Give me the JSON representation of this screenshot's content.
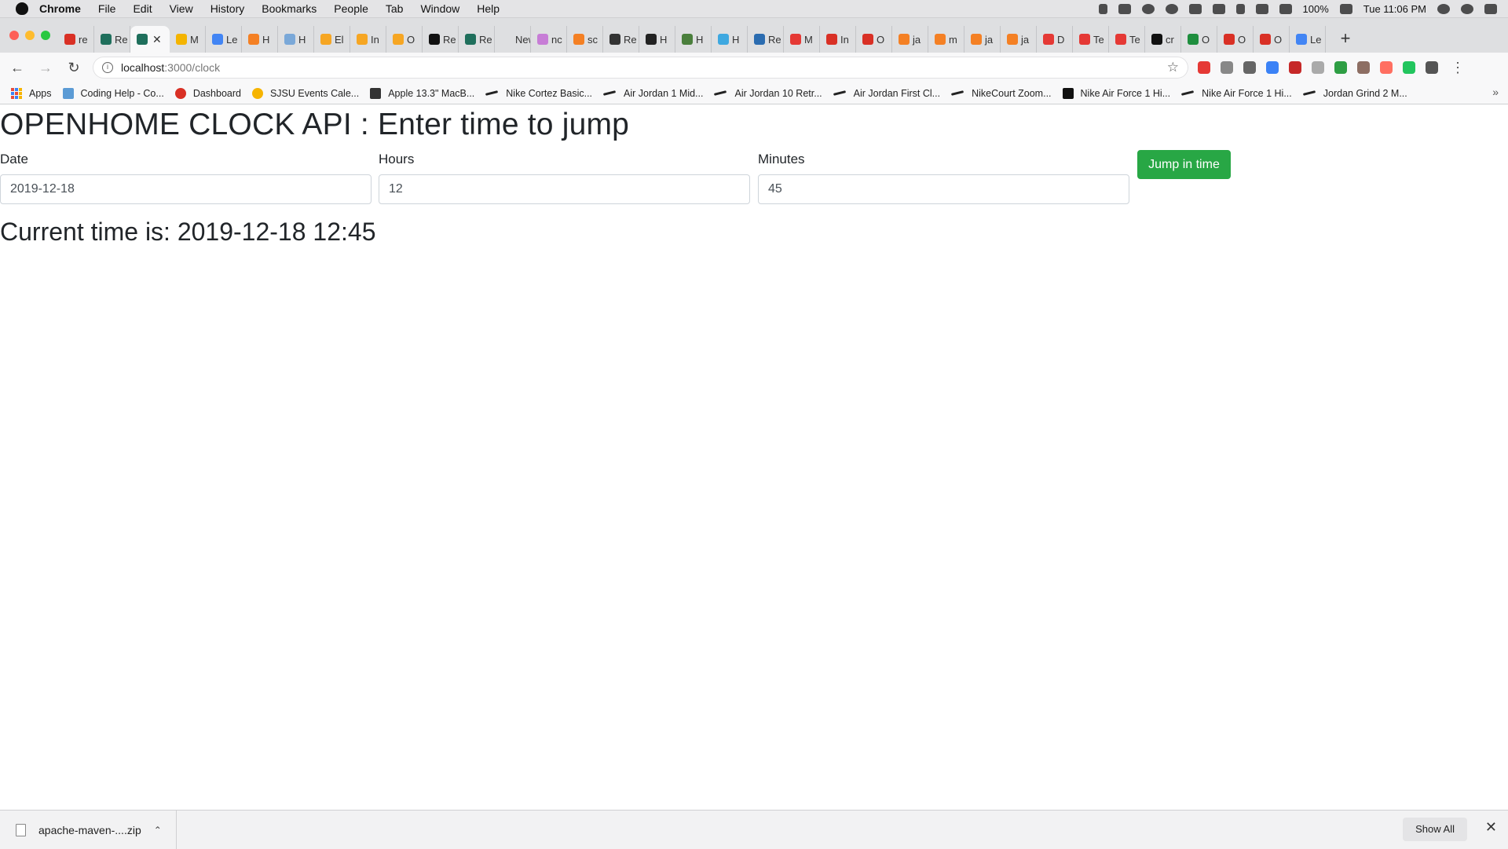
{
  "menubar": {
    "app_name": "Chrome",
    "items": [
      "File",
      "Edit",
      "View",
      "History",
      "Bookmarks",
      "People",
      "Tab",
      "Window",
      "Help"
    ],
    "battery": "100%",
    "clock": "Tue 11:06 PM"
  },
  "tabs": [
    {
      "label": "re",
      "color": "#d93025"
    },
    {
      "label": "Re",
      "color": "#1f6f5c"
    },
    {
      "label": "",
      "color": "#1f6f5c",
      "active": true
    },
    {
      "label": "M",
      "color": "#f4b400"
    },
    {
      "label": "Le",
      "color": "#4285f4"
    },
    {
      "label": "H",
      "color": "#f48024"
    },
    {
      "label": "H",
      "color": "#7aa8d8"
    },
    {
      "label": "El",
      "color": "#f6a623"
    },
    {
      "label": "In",
      "color": "#f6a623"
    },
    {
      "label": "O",
      "color": "#f6a623"
    },
    {
      "label": "Re",
      "color": "#111111"
    },
    {
      "label": "Re",
      "color": "#1f6f5c"
    },
    {
      "label": "New T",
      "color": "#dedfe1"
    },
    {
      "label": "nc",
      "color": "#c77dd6"
    },
    {
      "label": "sc",
      "color": "#f48024"
    },
    {
      "label": "Re",
      "color": "#333333"
    },
    {
      "label": "H",
      "color": "#222222"
    },
    {
      "label": "H",
      "color": "#4a7f3c"
    },
    {
      "label": "H",
      "color": "#3ea8e0"
    },
    {
      "label": "Re",
      "color": "#2b6cb0"
    },
    {
      "label": "M",
      "color": "#e53935"
    },
    {
      "label": "In",
      "color": "#d93025"
    },
    {
      "label": "O",
      "color": "#d93025"
    },
    {
      "label": "ja",
      "color": "#f48024"
    },
    {
      "label": "m",
      "color": "#f48024"
    },
    {
      "label": "ja",
      "color": "#f48024"
    },
    {
      "label": "ja",
      "color": "#f48024"
    },
    {
      "label": "D",
      "color": "#e53935"
    },
    {
      "label": "Te",
      "color": "#e53935"
    },
    {
      "label": "Te",
      "color": "#e53935"
    },
    {
      "label": "cr",
      "color": "#111111"
    },
    {
      "label": "O",
      "color": "#1e8e3e"
    },
    {
      "label": "O",
      "color": "#d93025"
    },
    {
      "label": "O",
      "color": "#d93025"
    },
    {
      "label": "Le",
      "color": "#4285f4"
    }
  ],
  "toolbar": {
    "url_host": "localhost",
    "url_path": ":3000/clock",
    "extension_colors": [
      "#e53935",
      "#888888",
      "#666666",
      "#3b82f6",
      "#c62828",
      "#aaaaaa",
      "#2e9e44",
      "#8d6e63",
      "#ff6f61",
      "#22c55e",
      "#555555"
    ]
  },
  "bookmarks": [
    {
      "label": "Apps",
      "icon": "apps-grid-icon"
    },
    {
      "label": "Coding Help - Co...",
      "icon": "cloud-icon",
      "color": "#5b9bd5"
    },
    {
      "label": "Dashboard",
      "icon": "circle-icon",
      "color": "#d93025"
    },
    {
      "label": "SJSU Events Cale...",
      "icon": "sun-icon",
      "color": "#f6b400"
    },
    {
      "label": "Apple 13.3\" MacB...",
      "icon": "bh-icon",
      "color": "#333333"
    },
    {
      "label": "Nike Cortez Basic...",
      "icon": "swoosh-icon"
    },
    {
      "label": "Air Jordan 1 Mid...",
      "icon": "swoosh-icon"
    },
    {
      "label": "Air Jordan 10 Retr...",
      "icon": "swoosh-icon"
    },
    {
      "label": "Air Jordan First Cl...",
      "icon": "swoosh-icon"
    },
    {
      "label": "NikeCourt Zoom...",
      "icon": "swoosh-icon"
    },
    {
      "label": "Nike Air Force 1 Hi...",
      "icon": "nike-box-icon",
      "color": "#111111"
    },
    {
      "label": "Nike Air Force 1 Hi...",
      "icon": "swoosh-icon"
    },
    {
      "label": "Jordan Grind 2 M...",
      "icon": "swoosh-icon"
    }
  ],
  "page": {
    "title": "OPENHOME CLOCK API : Enter time to jump",
    "date_label": "Date",
    "date_value": "2019-12-18",
    "hours_label": "Hours",
    "hours_value": "12",
    "minutes_label": "Minutes",
    "minutes_value": "45",
    "jump_button": "Jump in time",
    "current_time": "Current time is: 2019-12-18 12:45"
  },
  "downloads": {
    "file_name": "apache-maven-....zip",
    "show_all": "Show All"
  },
  "colors": {
    "button_green": "#28a745",
    "text_dark": "#212529"
  }
}
